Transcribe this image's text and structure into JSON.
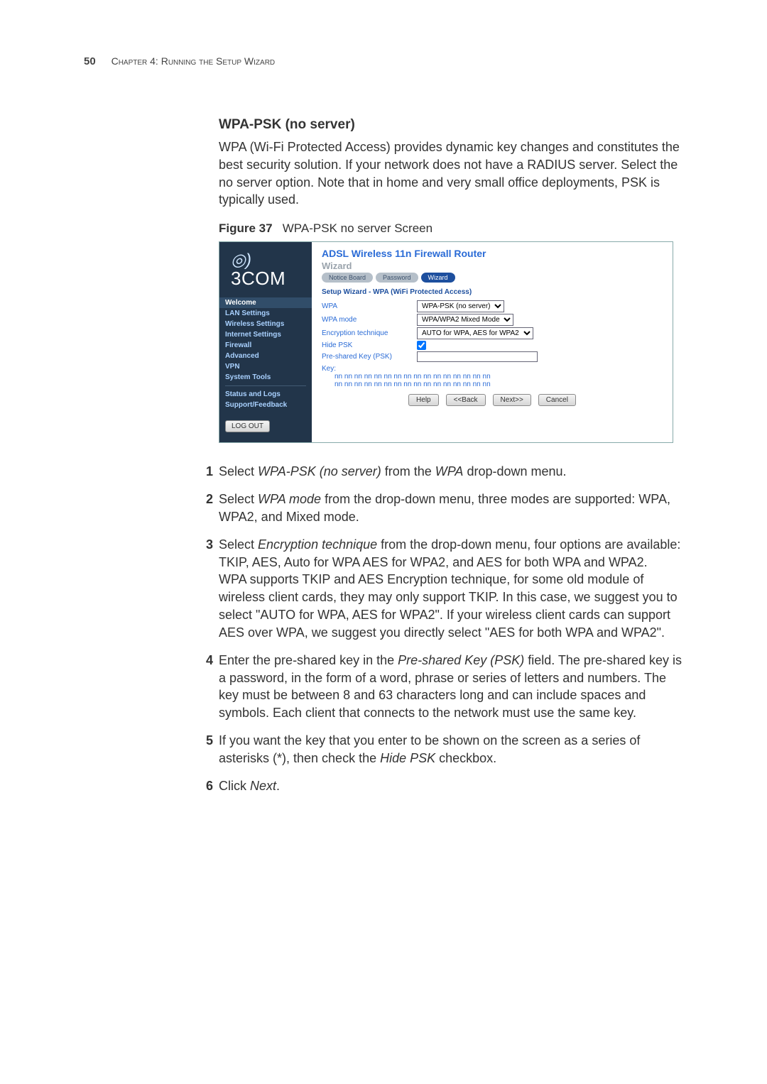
{
  "header": {
    "page_number": "50",
    "chapter": "Chapter 4: Running the Setup Wizard"
  },
  "section": {
    "title": "WPA-PSK (no server)",
    "intro": "WPA (Wi-Fi Protected Access) provides dynamic key changes and constitutes the best security solution. If your network does not have a RADIUS server. Select the no server option. Note that in home and very small office deployments, PSK is typically used."
  },
  "figure": {
    "label": "Figure 37",
    "caption": "WPA-PSK no server Screen"
  },
  "screenshot": {
    "brand": "3COM",
    "product": "ADSL Wireless 11n Firewall Router",
    "wizard_label": "Wizard",
    "tabs": [
      "Notice Board",
      "Password",
      "Wizard"
    ],
    "active_tab_index": 2,
    "panel_title": "Setup Wizard - WPA (WiFi Protected Access)",
    "nav": [
      "Welcome",
      "LAN Settings",
      "Wireless Settings",
      "Internet Settings",
      "Firewall",
      "Advanced",
      "VPN",
      "System Tools",
      "Status and Logs",
      "Support/Feedback"
    ],
    "logout": "LOG OUT",
    "form": {
      "wpa_label": "WPA",
      "wpa_value": "WPA-PSK (no server)",
      "mode_label": "WPA mode",
      "mode_value": "WPA/WPA2 Mixed Mode",
      "enc_label": "Encryption technique",
      "enc_value": "AUTO for WPA, AES for WPA2",
      "hide_label": "Hide PSK",
      "psk_label": "Pre-shared Key (PSK)",
      "psk_value": "",
      "key_label": "Key:",
      "key_mask": "nn nn nn nn nn nn nn nn nn nn nn nn nn nn nn nn\nnn nn nn nn nn nn nn nn nn nn nn nn nn nn nn nn"
    },
    "buttons": {
      "help": "Help",
      "back": "<<Back",
      "next": "Next>>",
      "cancel": "Cancel"
    }
  },
  "steps": {
    "s1a": "Select ",
    "s1i": "WPA-PSK (no server)",
    "s1b": " from the ",
    "s1j": "WPA",
    "s1c": " drop-down menu.",
    "s2a": "Select ",
    "s2i": "WPA mode",
    "s2b": " from the drop-down menu, three modes are supported: WPA, WPA2, and Mixed mode.",
    "s3a": "Select ",
    "s3i": "Encryption technique",
    "s3b": " from the drop-down menu, four options are available: TKIP, AES, Auto for WPA AES for WPA2, and AES for both WPA and WPA2.",
    "s3c": "WPA supports TKIP and AES Encryption technique, for some old module of wireless client cards, they may only support TKIP. In this case, we suggest you to select \"AUTO for WPA, AES for WPA2\". If your wireless client cards can support AES over WPA, we suggest you directly select \"AES for both WPA and WPA2\".",
    "s4a": "Enter the pre-shared key in the ",
    "s4i": "Pre-shared Key (PSK)",
    "s4b": " field. The pre-shared key is a password, in the form of a word, phrase or series of letters and numbers. The key must be between 8 and 63 characters long and can include spaces and symbols. Each client that connects to the network must use the same key.",
    "s5a": "If you want the key that you enter to be shown on the screen as a series of asterisks (*), then check the ",
    "s5i": "Hide PSK",
    "s5b": " checkbox.",
    "s6a": "Click ",
    "s6i": "Next",
    "s6b": "."
  }
}
